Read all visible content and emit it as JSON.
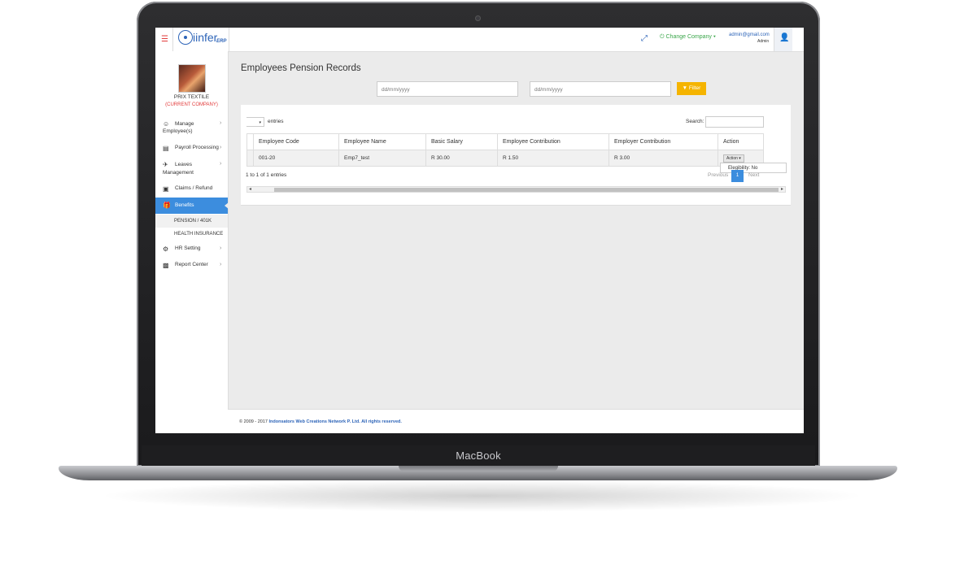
{
  "device": {
    "label": "MacBook"
  },
  "app": {
    "logo_text": "iinfer",
    "logo_suffix": "ERP",
    "change_company": "Change Company",
    "user_email": "admin@gmail.com",
    "user_role": "Admin"
  },
  "sidebar": {
    "company_name": "PRIX TEXTILE",
    "company_status": "(CURRENT COMPANY)",
    "items": [
      {
        "label": "Manage Employee(s)",
        "icon": "user-icon"
      },
      {
        "label": "Payroll Processing",
        "icon": "list-icon"
      },
      {
        "label": "Leaves Management",
        "icon": "plane-icon"
      },
      {
        "label": "Claims / Refund",
        "icon": "money-icon"
      },
      {
        "label": "Benefits",
        "icon": "gift-icon"
      },
      {
        "label": "HR Setting",
        "icon": "gear-icon"
      },
      {
        "label": "Report Center",
        "icon": "bar-chart-icon"
      }
    ],
    "benefits_sub": [
      "PENSION / 401K",
      "HEALTH INSURANCE"
    ]
  },
  "page": {
    "title": "Employees Pension Records",
    "date_from_placeholder": "dd/mm/yyyy",
    "date_to_placeholder": "dd/mm/yyyy",
    "filter_label": "Filter",
    "entries_label": "entries",
    "search_label": "Search:",
    "table": {
      "headers": [
        "Employee Code",
        "Employee Name",
        "Basic Salary",
        "Employee Contribution",
        "Employer Contribution",
        "Action"
      ],
      "rows": [
        [
          "001-20",
          "Emp7_test",
          "R 30.00",
          "R 1.50",
          "R 3.00",
          "Action"
        ]
      ]
    },
    "dropdown_item": "Elegibility: No",
    "info": "1 to 1 of 1 entries",
    "pagination": {
      "previous": "Previous",
      "current": "1",
      "next": "Next"
    }
  },
  "footer": {
    "copyright": "© 2009 - 2017",
    "company": "Indonsators Web Creations Network P. Ltd. All rights reserved."
  },
  "colors": {
    "accent": "#3c8dde",
    "filter": "#f5b400",
    "brand": "#2d64b8",
    "danger": "#e23b3b"
  }
}
